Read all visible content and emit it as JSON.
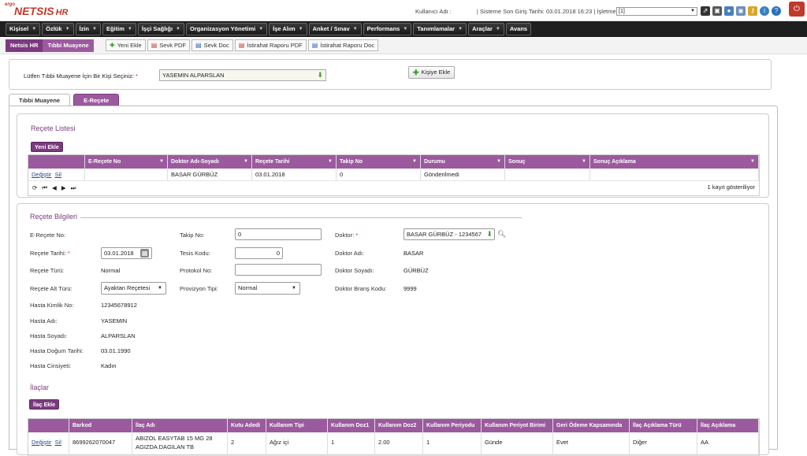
{
  "app": {
    "name_pre": "ergo",
    "name": "NETSIS",
    "name_suffix": "HR"
  },
  "header": {
    "user_label": "Kullanıcı Adı :",
    "last_login": "| Sisteme Son Giriş Tarihi: 03.01.2018 16:23 | İşletme:",
    "isletme_value": "[1]",
    "icons": [
      "external-link-icon",
      "window-icon",
      "user-icon",
      "users-icon",
      "key-icon",
      "info-icon",
      "help-icon",
      "power-icon"
    ]
  },
  "nav": [
    "Kişisel",
    "Özlük",
    "İzin",
    "Eğitim",
    "İşçi Sağlığı",
    "Organizasyon Yönetimi",
    "İşe Alım",
    "Anket / Sınav",
    "Performans",
    "Tanımlamalar",
    "Araçlar",
    "Avans"
  ],
  "breadcrumb": [
    "Netsis HR",
    "Tıbbi Muayene"
  ],
  "toolbar": [
    "Yeni Ekle",
    "Sevk PDF",
    "Sevk Doc",
    "İstirahat Raporu PDF",
    "İstirahat Raporu Doc"
  ],
  "picker": {
    "label": "Lütfen Tıbbi Muayene İçin Bir Kişi Seçiniz:",
    "value": "YASEMIN ALPARSLAN",
    "add_label": "Kişiye Ekle"
  },
  "tabs": [
    "Tıbbi Muayene",
    "E-Reçete"
  ],
  "recete_list": {
    "title": "Reçete Listesi",
    "new_label": "Yeni Ekle",
    "columns": [
      "",
      "E-Reçete No",
      "Doktor Adı-Soyadı",
      "Reçete Tarihi",
      "Takip No",
      "Durumu",
      "Sonuç",
      "Sonuç Açıklama"
    ],
    "row": {
      "change": "Değiştir",
      "delete": "Sil",
      "e_recete_no": "",
      "doctor": "BASAR GÜRBÜZ",
      "date": "03.01.2018",
      "takip": "0",
      "status": "Gönderilmedi",
      "result": "",
      "result_desc": ""
    },
    "footer": "1 kayıt gösteriliyor"
  },
  "recete_info": {
    "title": "Reçete Bilgileri",
    "e_recete_no_label": "E-Reçete No:",
    "recete_tarihi_label": "Reçete Tarihi:",
    "recete_tarihi": "03.01.2018",
    "recete_turu_label": "Reçete Türü:",
    "recete_turu": "Normal",
    "recete_alt_turu_label": "Reçete Alt Türü:",
    "recete_alt_turu": "Ayaktan Reçetesi",
    "hasta_kimlik_label": "Hasta Kimlik No:",
    "hasta_kimlik": "12345678912",
    "hasta_adi_label": "Hasta Adı:",
    "hasta_adi": "YASEMIN",
    "hasta_soyadi_label": "Hasta Soyadı:",
    "hasta_soyadi": "ALPARSLAN",
    "hasta_dogum_label": "Hasta Doğum Tarihi:",
    "hasta_dogum": "03.01.1990",
    "hasta_cinsiyet_label": "Hasta Cinsiyeti:",
    "hasta_cinsiyet": "Kadın",
    "takip_label": "Takip No:",
    "takip": "0",
    "tesis_label": "Tesis Kodu:",
    "tesis": "0",
    "protokol_label": "Protokol No:",
    "protokol": "",
    "provizyon_label": "Provizyon Tipi:",
    "provizyon": "Normal",
    "doktor_label": "Doktor:",
    "doktor": "BASAR GÜRBÜZ - 1234567",
    "doktor_adi_label": "Doktor Adı:",
    "doktor_adi": "BASAR",
    "doktor_soyadi_label": "Doktor Soyadı:",
    "doktor_soyadi": "GÜRBÜZ",
    "doktor_brans_label": "Doktor Branş Kodu:",
    "doktor_brans": "9999"
  },
  "ilaclar": {
    "title": "İlaçlar",
    "add_label": "İlaç Ekle",
    "columns": [
      "",
      "Barkod",
      "İlaç Adı",
      "Kutu Adedi",
      "Kullanım Tipi",
      "Kullanım Doz1",
      "Kullanım Doz2",
      "Kullanım Periyodu",
      "Kullanım Periyot Birimi",
      "Geri Ödeme Kapsamında",
      "İlaç Açıklama Türü",
      "İlaç Açıklama"
    ],
    "row": {
      "change": "Değiştir",
      "delete": "Sil",
      "barkod": "8699262070047",
      "ilac_line1": "ABIZOL EASYTAB 15 MG 28",
      "ilac_line2": "AGIZDA DAGILAN TB",
      "kutu": "2",
      "tip": "Ağız içi",
      "doz1": "1",
      "doz2": "2.00",
      "periyot": "1",
      "birim": "Günde",
      "geri_odeme": "Evet",
      "aciklama_turu": "Diğer",
      "aciklama": "AA"
    }
  },
  "colors": {
    "accent": "#9b5a9e",
    "accent_dark": "#7b3a7e",
    "nav_bg": "#1f1f1f",
    "danger": "#c0392b"
  }
}
